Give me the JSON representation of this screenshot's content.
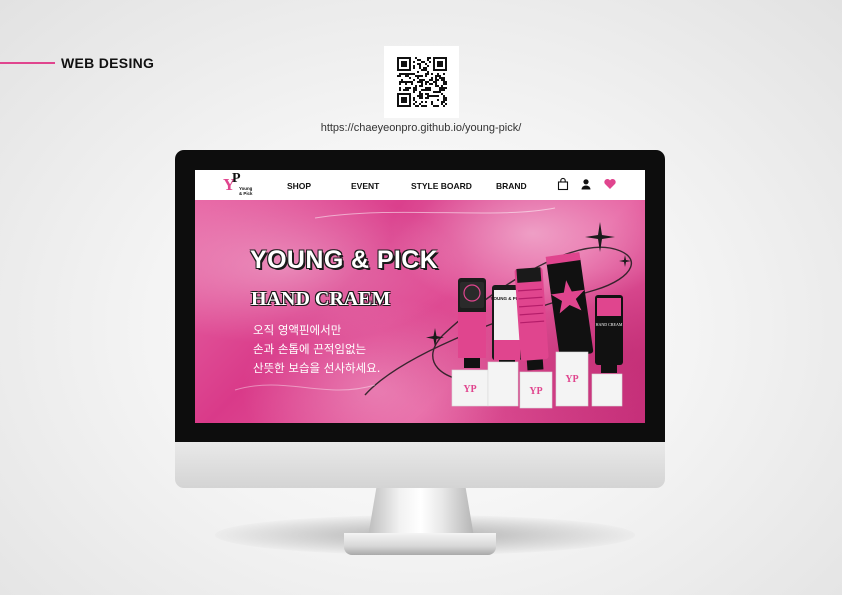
{
  "page": {
    "section_title": "WEB DESING",
    "project_url": "https://chaeyeonpro.github.io/young-pick/"
  },
  "site": {
    "logo": {
      "initials_y": "Y",
      "initials_p": "P",
      "line1": "Young",
      "line2": "& Pick"
    },
    "nav": {
      "items": [
        "SHOP",
        "EVENT",
        "STYLE BOARD",
        "BRAND"
      ]
    },
    "nav_icons": [
      "bag-icon",
      "user-icon",
      "heart-icon"
    ],
    "hero": {
      "title": "YOUNG & PICK",
      "subtitle": "HAND CRAEM",
      "description": [
        "오직 영액핀에서만",
        "손과 손톱에 끈적임없는",
        "산뜻한 보습을 선사하세요."
      ]
    },
    "products": {
      "brand_text": "YOUNG & PICK",
      "hand_cream_text": "HAND CREAM",
      "pedestal_logo": "YP"
    }
  },
  "colors": {
    "accent_pink": "#e0458e",
    "hero_pink": "#d93a89",
    "nav_text": "#111111",
    "monitor_bezel": "#0d0d0d"
  }
}
